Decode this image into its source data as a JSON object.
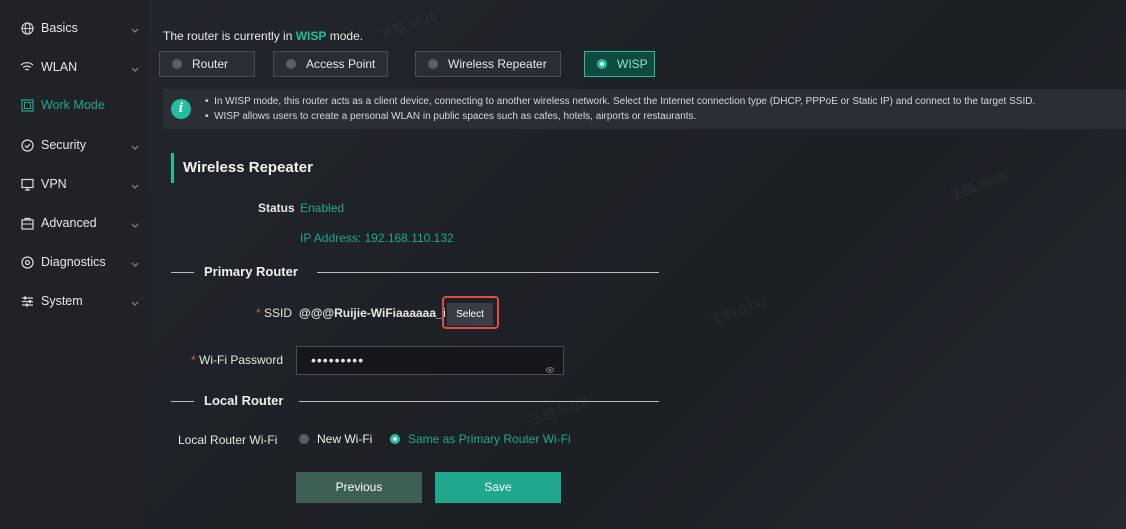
{
  "sidebar": {
    "items": [
      {
        "label": "Basics",
        "icon": "globe-icon"
      },
      {
        "label": "WLAN",
        "icon": "wifi-icon"
      },
      {
        "label": "Work Mode",
        "icon": "work-mode-icon"
      },
      {
        "label": "Security",
        "icon": "shield-icon"
      },
      {
        "label": "VPN",
        "icon": "monitor-icon"
      },
      {
        "label": "Advanced",
        "icon": "advanced-icon"
      },
      {
        "label": "Diagnostics",
        "icon": "diagnostics-icon"
      },
      {
        "label": "System",
        "icon": "system-icon"
      }
    ]
  },
  "mode_line": {
    "prefix": "The router is currently in",
    "mode": "WISP",
    "suffix": "mode."
  },
  "mode_buttons": [
    "Router",
    "Access Point",
    "Wireless Repeater",
    "WISP"
  ],
  "info": {
    "line1": "In WISP mode, this router acts as a client device, connecting to another wireless network. Select the Internet connection type (DHCP, PPPoE or Static IP) and connect to the target SSID.",
    "line2": "WISP allows users to create a personal WLAN in public spaces such as cafes, hotels, airports or restaurants."
  },
  "section_title": "Wireless Repeater",
  "status": {
    "label": "Status",
    "value": "Enabled",
    "ip": "IP Address: 192.168.110.132"
  },
  "primary_router": {
    "title": "Primary Router",
    "ssid_label": "SSID",
    "ssid_value": "@@@Ruijie-WiFiaaaaaa_ict",
    "select_label": "Select",
    "password_label": "Wi-Fi Password",
    "password_value": "•••••••••"
  },
  "local_router": {
    "title": "Local Router",
    "wifi_label": "Local Router Wi-Fi",
    "options": [
      "New Wi-Fi",
      "Same as Primary Router Wi-Fi"
    ]
  },
  "buttons": {
    "previous": "Previous",
    "save": "Save"
  },
  "watermark": "王鹏 8039",
  "colors": {
    "accent": "#1fbf9f",
    "highlight": "#e54a4a"
  }
}
